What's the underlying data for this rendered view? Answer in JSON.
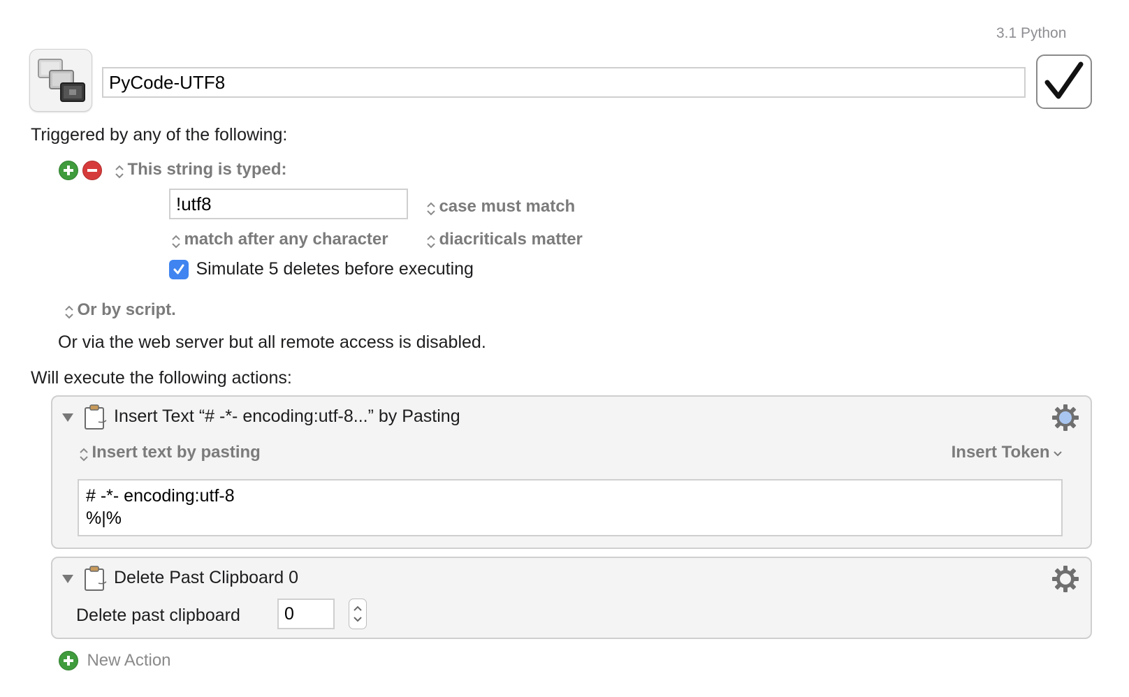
{
  "header": {
    "version_label": "3.1 Python",
    "macro_name": "PyCode-UTF8",
    "macro_icon": "macro-icon",
    "enabled_icon": "checkmark-icon"
  },
  "trigger": {
    "heading": "Triggered by any of the following:",
    "type_label": "This string is typed:",
    "typed_string": "!utf8",
    "case_option": "case must match",
    "match_option": "match after any character",
    "diacritics_option": "diacriticals matter",
    "simulate_label": "Simulate 5 deletes before executing",
    "simulate_checked": true,
    "script_option": "Or by script.",
    "webserver_text": "Or via the web server but all remote access is disabled."
  },
  "actions": {
    "heading": "Will execute the following actions:",
    "items": [
      {
        "title": "Insert Text “# -*- encoding:utf-8...” by Pasting",
        "mode_label": "Insert text by pasting",
        "token_label": "Insert Token",
        "text": "# -*- encoding:utf-8\n%|%"
      },
      {
        "title": "Delete Past Clipboard 0",
        "field_label": "Delete past clipboard",
        "field_value": "0"
      }
    ],
    "new_action_label": "New Action"
  },
  "colors": {
    "accent_blue": "#3f84f0",
    "add_green": "#3f9b3c",
    "remove_red": "#d63b3b",
    "panel_bg": "#f4f4f4"
  }
}
